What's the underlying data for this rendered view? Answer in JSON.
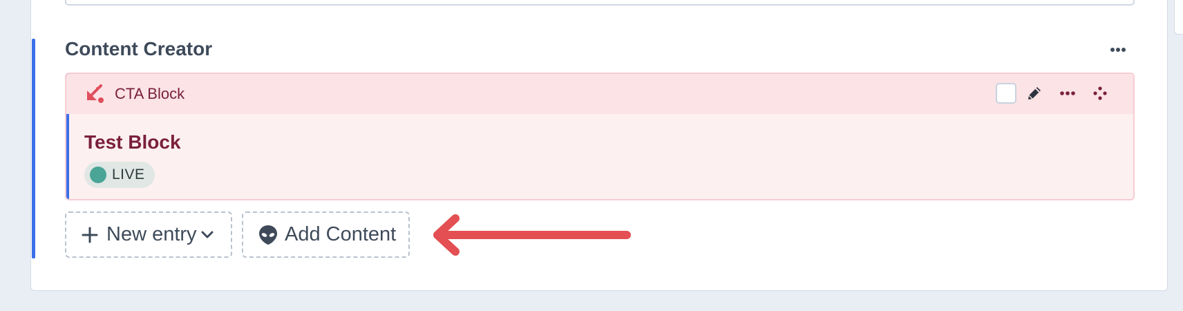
{
  "field": {
    "label": "Content Creator",
    "actions_icon": "ellipsis-icon"
  },
  "block": {
    "type_label": "CTA Block",
    "type_icon": "cta-arrow-icon",
    "title": "Test Block",
    "status": "LIVE",
    "header_actions": [
      "select-checkbox",
      "edit-icon",
      "ellipsis-icon",
      "move-icon"
    ]
  },
  "buttons": {
    "new_entry": "New entry",
    "add_content": "Add Content"
  },
  "colors": {
    "accent": "#3b6fe8",
    "block_bg": "#fcf0f0",
    "block_header_bg": "#fbe3e6",
    "block_text": "#7a1f3d",
    "block_icon": "#e04e5c",
    "status_live": "#4aa596",
    "annotation_arrow": "#e34f52"
  },
  "annotation": {
    "icon": "red-arrow-pointing-left"
  }
}
